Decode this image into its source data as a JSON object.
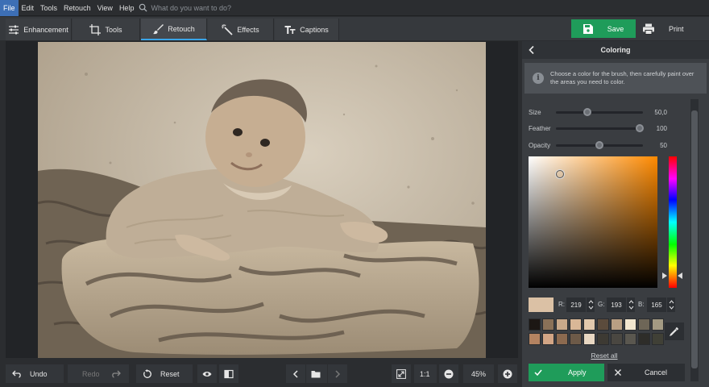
{
  "menu": {
    "items": [
      "File",
      "Edit",
      "Tools",
      "Retouch",
      "View",
      "Help"
    ],
    "active": "File",
    "search_placeholder": "What do you want to do?"
  },
  "toolbar": {
    "tabs": [
      {
        "label": "Enhancement",
        "icon": "sliders-icon"
      },
      {
        "label": "Tools",
        "icon": "crop-icon"
      },
      {
        "label": "Retouch",
        "icon": "brush-icon"
      },
      {
        "label": "Effects",
        "icon": "magic-wand-icon"
      },
      {
        "label": "Captions",
        "icon": "text-icon"
      }
    ],
    "active_tab": "Retouch",
    "save_label": "Save",
    "print_label": "Print"
  },
  "bottombar": {
    "undo_label": "Undo",
    "redo_label": "Redo",
    "reset_label": "Reset",
    "zoom_1to1": "1:1",
    "zoom_value": "45%"
  },
  "panel": {
    "title": "Coloring",
    "info_text": "Choose a color for the brush, then carefully paint over the areas you need to color.",
    "sliders": [
      {
        "label": "Size",
        "value": "50,0",
        "level": 0.36
      },
      {
        "label": "Feather",
        "value": "100",
        "level": 0.96
      },
      {
        "label": "Opacity",
        "value": "50",
        "level": 0.5
      }
    ],
    "color": {
      "r_label": "R:",
      "r": "219",
      "g_label": "G:",
      "g": "193",
      "b_label": "B:",
      "b": "165",
      "current_hex": "#dbc1a5",
      "field_hue_hex": "#ff8a00"
    },
    "swatches": [
      "#1c1714",
      "#8a7158",
      "#c9a98a",
      "#d9b797",
      "#e2c9ad",
      "#5b4b3c",
      "#b99f83",
      "#f2e6cf",
      "#6e6657",
      "#a39a83",
      "#b38361",
      "#d2a585",
      "#8c6a4f",
      "#6d5a48",
      "#e8d7c2",
      "#3d3a33",
      "#4a4741",
      "#5a574f",
      "#2e2d29",
      "#404036"
    ],
    "reset_all_label": "Reset all",
    "apply_label": "Apply",
    "cancel_label": "Cancel"
  }
}
